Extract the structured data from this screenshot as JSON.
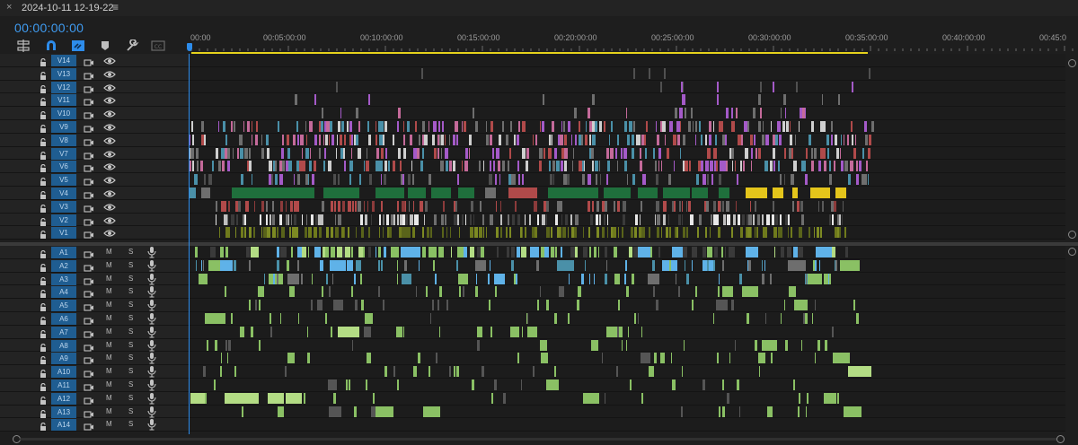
{
  "tab": {
    "close_glyph": "×",
    "title": "2024-10-11 12-19-22",
    "menu_glyph": "≡"
  },
  "timecode": "00:00:00:00",
  "tools": [
    {
      "name": "insert-overwrite-icon",
      "icon": "nest-sequence"
    },
    {
      "name": "snap-icon",
      "icon": "magnet"
    },
    {
      "name": "linked-selection-icon",
      "icon": "link"
    },
    {
      "name": "add-marker-icon",
      "icon": "marker"
    },
    {
      "name": "timeline-settings-icon",
      "icon": "wrench"
    },
    {
      "name": "captions-icon",
      "icon": "cc"
    }
  ],
  "ruler": {
    "labels": [
      "00:00",
      "00:05:00:00",
      "00:10:00:00",
      "00:15:00:00",
      "00:20:00:00",
      "00:25:00:00",
      "00:30:00:00",
      "00:35:00:00",
      "00:40:00:00",
      "00:45:0"
    ]
  },
  "video_tracks": [
    "V14",
    "V13",
    "V12",
    "V11",
    "V10",
    "V9",
    "V8",
    "V7",
    "V6",
    "V5",
    "V4",
    "V3",
    "V2",
    "V1"
  ],
  "audio_tracks": [
    "A1",
    "A2",
    "A3",
    "A4",
    "A5",
    "A6",
    "A7",
    "A8",
    "A9",
    "A10",
    "A11",
    "A12",
    "A13",
    "A14"
  ],
  "audio_mute_label": "M",
  "audio_solo_label": "S",
  "colors": {
    "accent": "#2d8ceb",
    "track_label_bg": "#1f5d91",
    "work_area": "#e5d21c",
    "clip_magenta": "#a45ac8",
    "clip_pink": "#c46a9a",
    "clip_gray": "#6e6e6e",
    "clip_teal": "#4a90a8",
    "clip_green": "#1f6f3c",
    "clip_yellow": "#e4c51b",
    "clip_red": "#b04a4a",
    "clip_white": "#e8e8e8",
    "clip_olive": "#6f7a1c",
    "clip_audio": "#8ac064",
    "clip_audio_light": "#b3dc84",
    "clip_audio_blue": "#5fb2e8"
  },
  "timeline_summary": {
    "sequence_duration_approx": "00:35:00:00"
  }
}
